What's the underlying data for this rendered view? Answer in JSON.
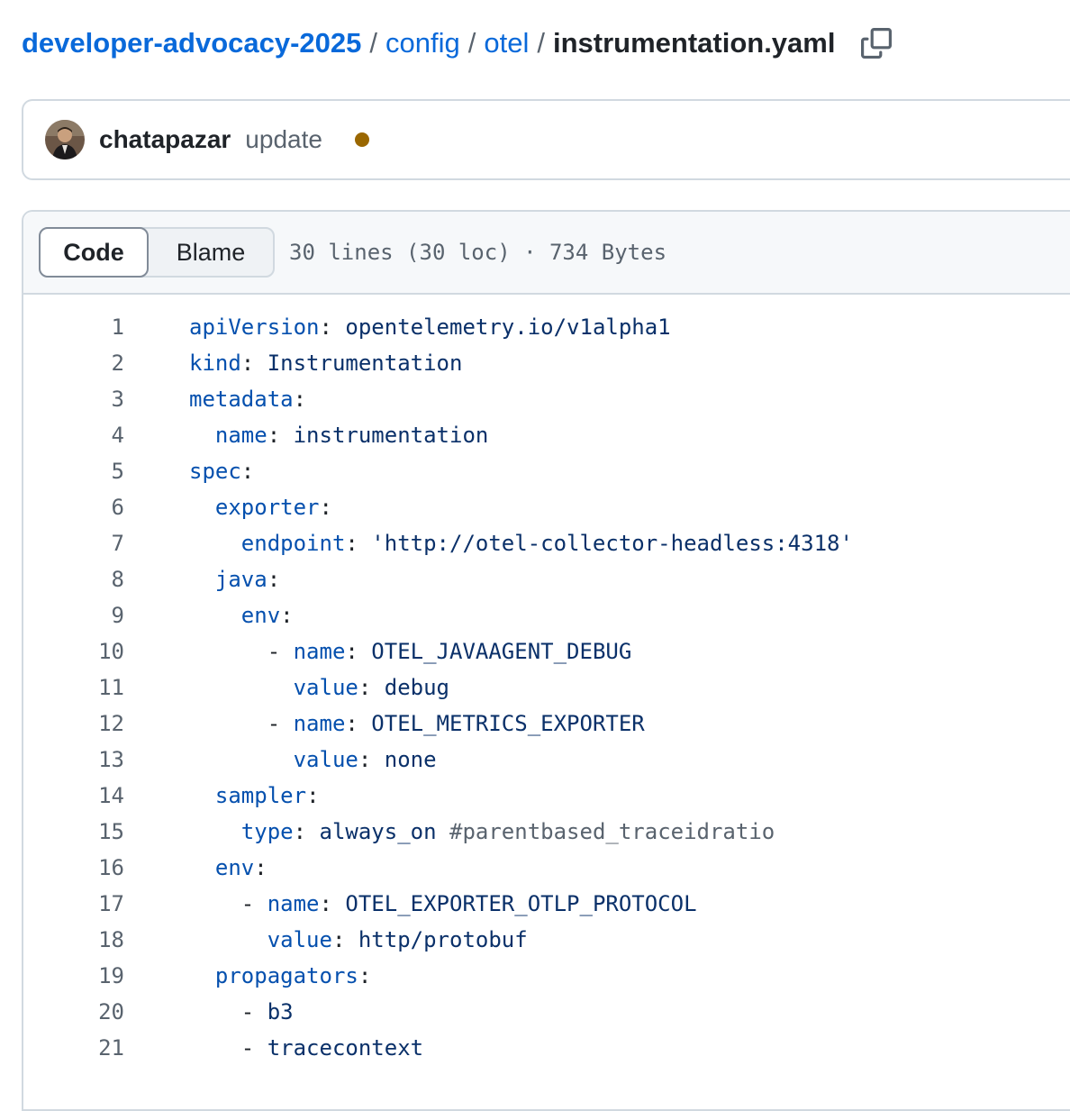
{
  "breadcrumb": {
    "repo": "developer-advocacy-2025",
    "sep1": "/",
    "dir1": "config",
    "sep2": "/",
    "dir2": "otel",
    "sep3": "/",
    "file": "instrumentation.yaml",
    "copy_icon": "copy-icon"
  },
  "commit": {
    "author": "chatapazar",
    "message": "update",
    "status_color": "#9a6700"
  },
  "file_header": {
    "tabs": [
      {
        "label": "Code",
        "selected": true
      },
      {
        "label": "Blame",
        "selected": false
      }
    ],
    "info": "30 lines (30 loc) · 734 Bytes"
  },
  "colors": {
    "link": "#0969da",
    "yaml_key": "#0550ae",
    "yaml_value": "#0a3069",
    "comment": "#59636e"
  },
  "code_lines": [
    {
      "num": "1",
      "indent": "",
      "dash": "",
      "key": "apiVersion",
      "colon": ":",
      "value": " opentelemetry.io/v1alpha1",
      "comment": ""
    },
    {
      "num": "2",
      "indent": "",
      "dash": "",
      "key": "kind",
      "colon": ":",
      "value": " Instrumentation",
      "comment": ""
    },
    {
      "num": "3",
      "indent": "",
      "dash": "",
      "key": "metadata",
      "colon": ":",
      "value": "",
      "comment": ""
    },
    {
      "num": "4",
      "indent": "  ",
      "dash": "",
      "key": "name",
      "colon": ":",
      "value": " instrumentation",
      "comment": ""
    },
    {
      "num": "5",
      "indent": "",
      "dash": "",
      "key": "spec",
      "colon": ":",
      "value": "",
      "comment": ""
    },
    {
      "num": "6",
      "indent": "  ",
      "dash": "",
      "key": "exporter",
      "colon": ":",
      "value": "",
      "comment": ""
    },
    {
      "num": "7",
      "indent": "    ",
      "dash": "",
      "key": "endpoint",
      "colon": ":",
      "value": " 'http://otel-collector-headless:4318'",
      "comment": ""
    },
    {
      "num": "8",
      "indent": "  ",
      "dash": "",
      "key": "java",
      "colon": ":",
      "value": "",
      "comment": ""
    },
    {
      "num": "9",
      "indent": "    ",
      "dash": "",
      "key": "env",
      "colon": ":",
      "value": "",
      "comment": ""
    },
    {
      "num": "10",
      "indent": "      ",
      "dash": "- ",
      "key": "name",
      "colon": ":",
      "value": " OTEL_JAVAAGENT_DEBUG",
      "comment": ""
    },
    {
      "num": "11",
      "indent": "        ",
      "dash": "",
      "key": "value",
      "colon": ":",
      "value": " debug",
      "comment": ""
    },
    {
      "num": "12",
      "indent": "      ",
      "dash": "- ",
      "key": "name",
      "colon": ":",
      "value": " OTEL_METRICS_EXPORTER",
      "comment": ""
    },
    {
      "num": "13",
      "indent": "        ",
      "dash": "",
      "key": "value",
      "colon": ":",
      "value": " none",
      "comment": ""
    },
    {
      "num": "14",
      "indent": "  ",
      "dash": "",
      "key": "sampler",
      "colon": ":",
      "value": "",
      "comment": ""
    },
    {
      "num": "15",
      "indent": "    ",
      "dash": "",
      "key": "type",
      "colon": ":",
      "value": " always_on ",
      "comment": "#parentbased_traceidratio"
    },
    {
      "num": "16",
      "indent": "  ",
      "dash": "",
      "key": "env",
      "colon": ":",
      "value": "",
      "comment": ""
    },
    {
      "num": "17",
      "indent": "    ",
      "dash": "- ",
      "key": "name",
      "colon": ":",
      "value": " OTEL_EXPORTER_OTLP_PROTOCOL",
      "comment": ""
    },
    {
      "num": "18",
      "indent": "      ",
      "dash": "",
      "key": "value",
      "colon": ":",
      "value": " http/protobuf",
      "comment": ""
    },
    {
      "num": "19",
      "indent": "  ",
      "dash": "",
      "key": "propagators",
      "colon": ":",
      "value": "",
      "comment": ""
    },
    {
      "num": "20",
      "indent": "    ",
      "dash": "- ",
      "key": "",
      "colon": "",
      "value": "b3",
      "comment": ""
    },
    {
      "num": "21",
      "indent": "    ",
      "dash": "- ",
      "key": "",
      "colon": "",
      "value": "tracecontext",
      "comment": ""
    }
  ]
}
